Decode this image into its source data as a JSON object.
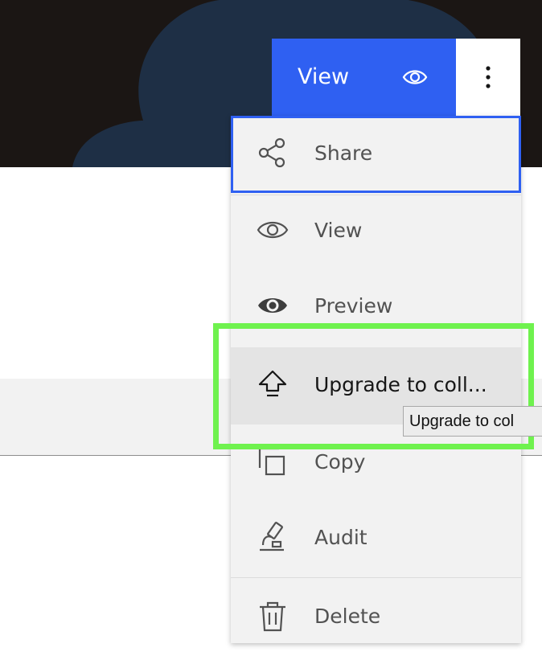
{
  "header": {
    "view_button_label": "View",
    "view_button_icon": "eye-icon",
    "overflow_icon": "overflow-menu-vertical-icon"
  },
  "menu": {
    "items": [
      {
        "label": "Share",
        "icon": "share-icon",
        "state": "focused"
      },
      {
        "label": "View",
        "icon": "eye-outline-icon",
        "state": "normal"
      },
      {
        "label": "Preview",
        "icon": "eye-filled-icon",
        "state": "normal"
      },
      {
        "label": "Upgrade to coll...",
        "icon": "upgrade-icon",
        "state": "hovered"
      },
      {
        "label": "Copy",
        "icon": "copy-icon",
        "state": "normal"
      },
      {
        "label": "Audit",
        "icon": "microscope-icon",
        "state": "normal"
      },
      {
        "label": "Delete",
        "icon": "trash-can-icon",
        "state": "normal"
      }
    ]
  },
  "tooltip": {
    "text": "Upgrade to col"
  },
  "colors": {
    "primary": "#2f60f2",
    "menu_bg": "#f2f2f2",
    "hover_bg": "#e4e4e4",
    "highlight": "#6ff24e",
    "hero_bg": "#1b1614"
  }
}
